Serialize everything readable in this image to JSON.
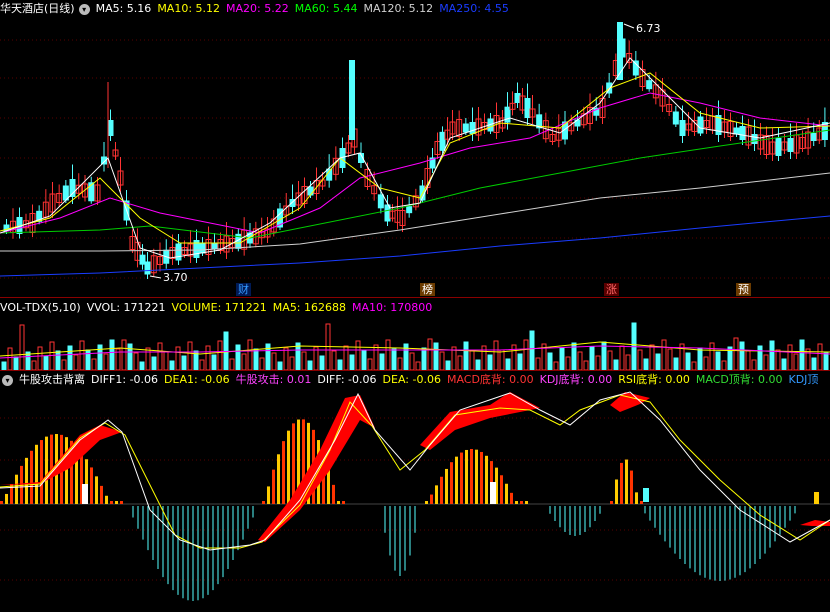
{
  "main": {
    "title": "华天酒店(日线)",
    "ma": [
      {
        "label": "MA5: 5.16",
        "color": "#ffffff"
      },
      {
        "label": "MA10: 5.12",
        "color": "#ffff00"
      },
      {
        "label": "MA20: 5.22",
        "color": "#ff00ff"
      },
      {
        "label": "MA60: 5.44",
        "color": "#00ff00"
      },
      {
        "label": "MA120: 5.12",
        "color": "#d0d0d0"
      },
      {
        "label": "MA250: 4.55",
        "color": "#1a3cff"
      }
    ],
    "high_label": "6.73",
    "low_label": "3.70",
    "markers": [
      {
        "text": "财",
        "color": "#3399ff"
      },
      {
        "text": "榜",
        "color": "#ffffff"
      },
      {
        "text": "涨",
        "color": "#ff3333"
      },
      {
        "text": "预",
        "color": "#ffffff"
      }
    ]
  },
  "volume": {
    "title": "VOL-TDX(5,10)",
    "items": [
      {
        "label": "VVOL: 171221",
        "color": "#ffffff"
      },
      {
        "label": "VOLUME: 171221",
        "color": "#ffff00"
      },
      {
        "label": "MA5: 162688",
        "color": "#ffff00"
      },
      {
        "label": "MA10: 170800",
        "color": "#ff00ff"
      }
    ]
  },
  "indicator": {
    "title": "牛股攻击背离",
    "items": [
      {
        "label": "DIFF1: -0.06",
        "color": "#ffffff"
      },
      {
        "label": "DEA1: -0.06",
        "color": "#ffff00"
      },
      {
        "label": "牛股攻击: 0.01",
        "color": "#ff44ff"
      },
      {
        "label": "DIFF: -0.06",
        "color": "#ffffff"
      },
      {
        "label": "DEA: -0.06",
        "color": "#ffff00"
      },
      {
        "label": "MACD底背: 0.00",
        "color": "#ff3333"
      },
      {
        "label": "KDJ底背: 0.00",
        "color": "#ff44ff"
      },
      {
        "label": "RSI底背: 0.00",
        "color": "#ffff00"
      },
      {
        "label": "MACD顶背: 0.00",
        "color": "#33dd33"
      },
      {
        "label": "KDJ顶",
        "color": "#3399ff"
      }
    ]
  },
  "colors": {
    "up": "#ff3333",
    "down": "#54ffff",
    "grid": "#8a0000",
    "separator": "#8a0000"
  },
  "icons": {
    "settings": "settings-circle-icon"
  }
}
